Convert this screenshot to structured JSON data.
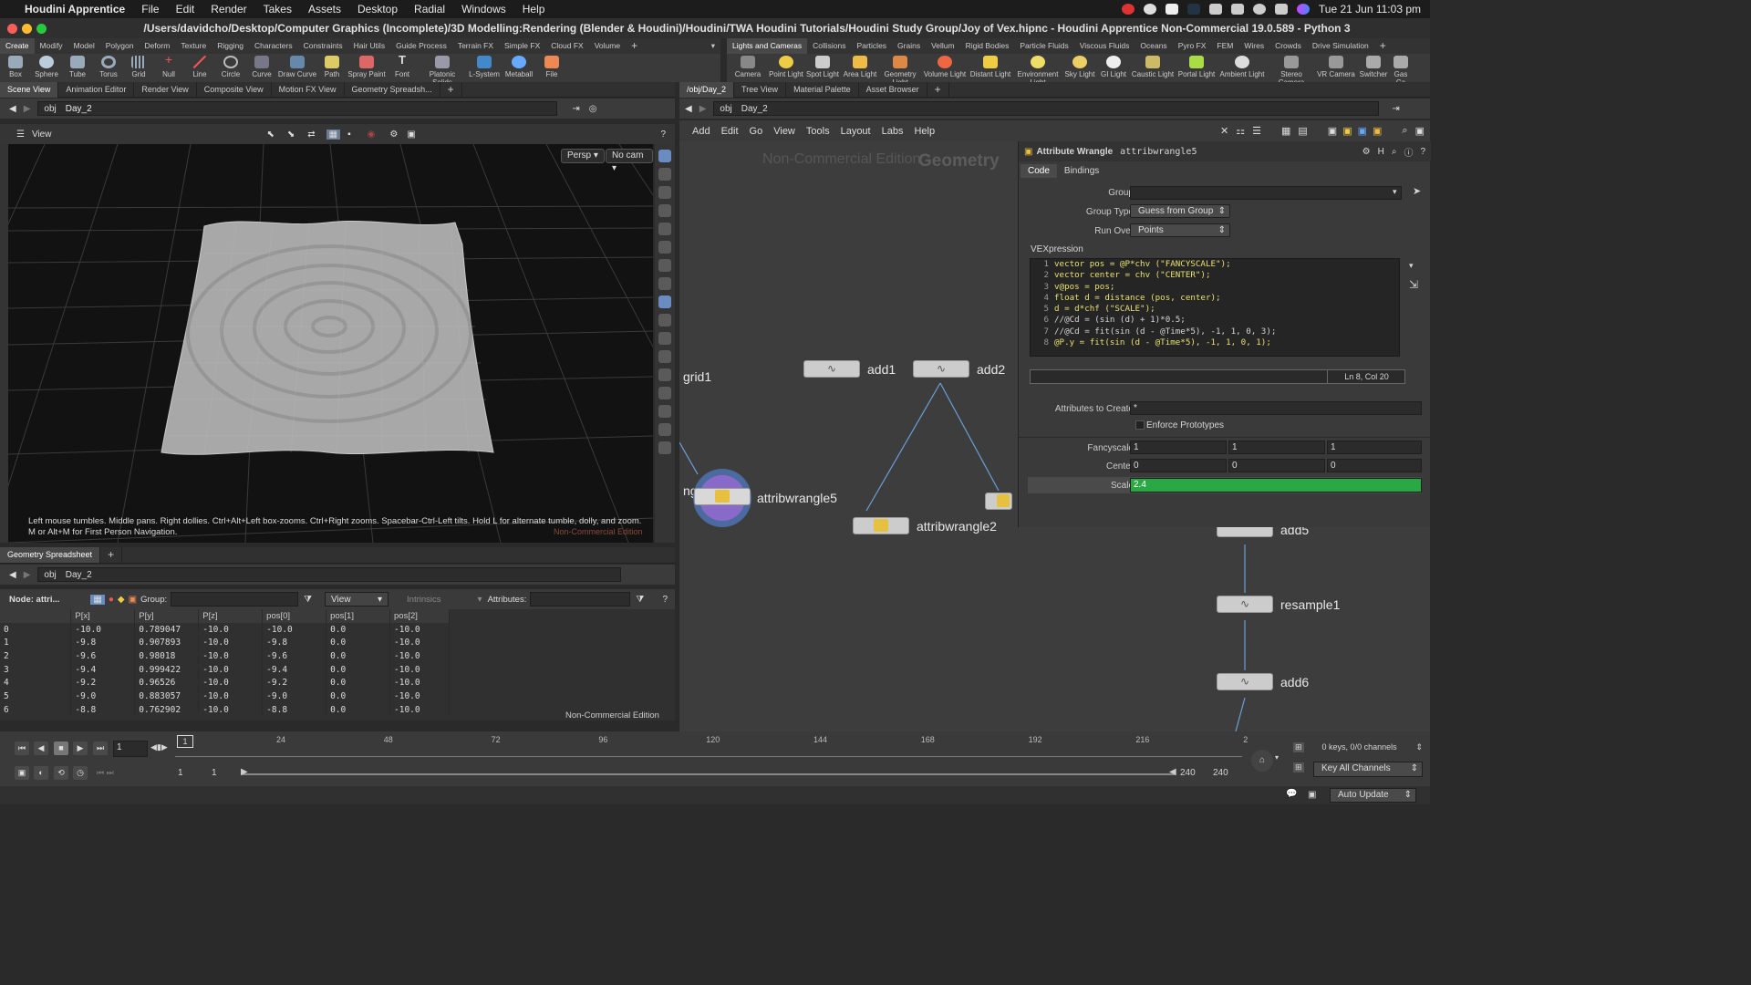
{
  "menubar": {
    "app": "Houdini Apprentice",
    "items": [
      "File",
      "Edit",
      "Render",
      "Takes",
      "Assets",
      "Desktop",
      "Radial",
      "Windows",
      "Help"
    ],
    "clock": "Tue 21 Jun  11:03 pm"
  },
  "window": {
    "title": "/Users/davidcho/Desktop/Computer Graphics (Incomplete)/3D Modelling:Rendering (Blender & Houdini)/Houdini/TWA Houdini Tutorials/Houdini Study Group/Joy of Vex.hipnc - Houdini Apprentice Non-Commercial 19.0.589 - Python 3"
  },
  "shelf_left": {
    "tabs": [
      "Create",
      "Modify",
      "Model",
      "Polygon",
      "Deform",
      "Texture",
      "Rigging",
      "Characters",
      "Constraints",
      "Hair Utils",
      "Guide Process",
      "Terrain FX",
      "Simple FX",
      "Cloud FX",
      "Volume"
    ],
    "tools": [
      "Box",
      "Sphere",
      "Tube",
      "Torus",
      "Grid",
      "Null",
      "Line",
      "Circle",
      "Curve",
      "Draw Curve",
      "Path",
      "Spray Paint",
      "Font",
      "Platonic Solids",
      "L-System",
      "Metaball",
      "File"
    ]
  },
  "shelf_right": {
    "tabs": [
      "Lights and Cameras",
      "Collisions",
      "Particles",
      "Grains",
      "Vellum",
      "Rigid Bodies",
      "Particle Fluids",
      "Viscous Fluids",
      "Oceans",
      "Pyro FX",
      "FEM",
      "Wires",
      "Crowds",
      "Drive Simulation"
    ],
    "tools": [
      "Camera",
      "Point Light",
      "Spot Light",
      "Area Light",
      "Geometry Light",
      "Volume Light",
      "Distant Light",
      "Environment Light",
      "Sky Light",
      "GI Light",
      "Caustic Light",
      "Portal Light",
      "Ambient Light",
      "Stereo Camera",
      "VR Camera",
      "Switcher",
      "Gas Ca"
    ]
  },
  "left_panetabs": [
    "Scene View",
    "Animation Editor",
    "Render View",
    "Composite View",
    "Motion FX View",
    "Geometry Spreadsh..."
  ],
  "right_panetabs": [
    "/obj/Day_2",
    "Tree View",
    "Material Palette",
    "Asset Browser"
  ],
  "path": {
    "root": "obj",
    "node": "Day_2"
  },
  "viewport": {
    "label": "View",
    "persp": "Persp",
    "cam": "No cam",
    "hint": "Left mouse tumbles. Middle pans. Right dollies. Ctrl+Alt+Left box-zooms. Ctrl+Right zooms. Spacebar-Ctrl-Left tilts. Hold L for alternate tumble, dolly, and zoom.    M or Alt+M for First Person Navigation.",
    "watermark": "Non-Commercial Edition"
  },
  "spreadsheet": {
    "tab": "Geometry Spreadsheet",
    "node": "Node: attri...",
    "group_label": "Group:",
    "view_label": "View",
    "intrinsics_label": "Intrinsics",
    "attributes_label": "Attributes:",
    "columns": [
      "",
      "P[x]",
      "P[y]",
      "P[z]",
      "pos[0]",
      "pos[1]",
      "pos[2]"
    ],
    "rows": [
      [
        "0",
        "-10.0",
        "0.789047",
        "-10.0",
        "-10.0",
        "0.0",
        "-10.0"
      ],
      [
        "1",
        "-9.8",
        "0.907893",
        "-10.0",
        "-9.8",
        "0.0",
        "-10.0"
      ],
      [
        "2",
        "-9.6",
        "0.98018",
        "-10.0",
        "-9.6",
        "0.0",
        "-10.0"
      ],
      [
        "3",
        "-9.4",
        "0.999422",
        "-10.0",
        "-9.4",
        "0.0",
        "-10.0"
      ],
      [
        "4",
        "-9.2",
        "0.96526",
        "-10.0",
        "-9.2",
        "0.0",
        "-10.0"
      ],
      [
        "5",
        "-9.0",
        "0.883057",
        "-10.0",
        "-9.0",
        "0.0",
        "-10.0"
      ],
      [
        "6",
        "-8.8",
        "0.762902",
        "-10.0",
        "-8.8",
        "0.0",
        "-10.0"
      ]
    ],
    "watermark": "Non-Commercial Edition"
  },
  "network": {
    "menu": [
      "Add",
      "Edit",
      "Go",
      "View",
      "Tools",
      "Layout",
      "Labs",
      "Help"
    ],
    "watermark": "Non-Commercial Edition",
    "context": "Geometry",
    "nodes": {
      "grid1": "grid1",
      "add1": "add1",
      "add2": "add2",
      "attribwrangle5": "attribwrangle5",
      "attribwrangle2": "attribwrangle2",
      "add5": "add5",
      "resample1": "resample1",
      "add6": "add6",
      "partial": "ngle"
    }
  },
  "parms": {
    "node_type": "Attribute Wrangle",
    "node_name": "attribwrangle5",
    "tabs": [
      "Code",
      "Bindings"
    ],
    "group_label": "Group",
    "group_value": "",
    "group_type_label": "Group Type",
    "group_type_value": "Guess from Group",
    "run_over_label": "Run Over",
    "run_over_value": "Points",
    "vex_label": "VEXpression",
    "code_lines": [
      "vector pos = @P*chv (\"FANCYSCALE\");",
      "vector center = chv (\"CENTER\");",
      "v@pos = pos;",
      "float d = distance (pos, center);",
      "d = d*chf (\"SCALE\");",
      "//@Cd = (sin (d) + 1)*0.5;",
      "//@Cd = fit(sin (d - @Time*5), -1, 1, 0, 3);",
      "@P.y = fit(sin (d - @Time*5), -1, 1, 0, 1);"
    ],
    "cursor_pos": "Ln 8, Col 20",
    "attrs_create_label": "Attributes to Create",
    "attrs_create_value": "*",
    "enforce_label": "Enforce Prototypes",
    "fancyscale_label": "Fancyscale",
    "fancyscale": [
      "1",
      "1",
      "1"
    ],
    "center_label": "Center",
    "center": [
      "0",
      "0",
      "0"
    ],
    "scale_label": "Scale",
    "scale": "2.4",
    "scale_fill": 1.0
  },
  "timeline": {
    "frame": "1",
    "ticks": [
      "24",
      "48",
      "72",
      "96",
      "120",
      "144",
      "168",
      "192",
      "216",
      "2"
    ],
    "start1": "1",
    "start2": "1",
    "end1": "240",
    "end2": "240",
    "keys": "0 keys, 0/0 channels",
    "key_all": "Key All Channels",
    "auto_update": "Auto Update"
  },
  "colors": {
    "scale_green": "#2aa846",
    "wire": "#6aa0d8"
  }
}
